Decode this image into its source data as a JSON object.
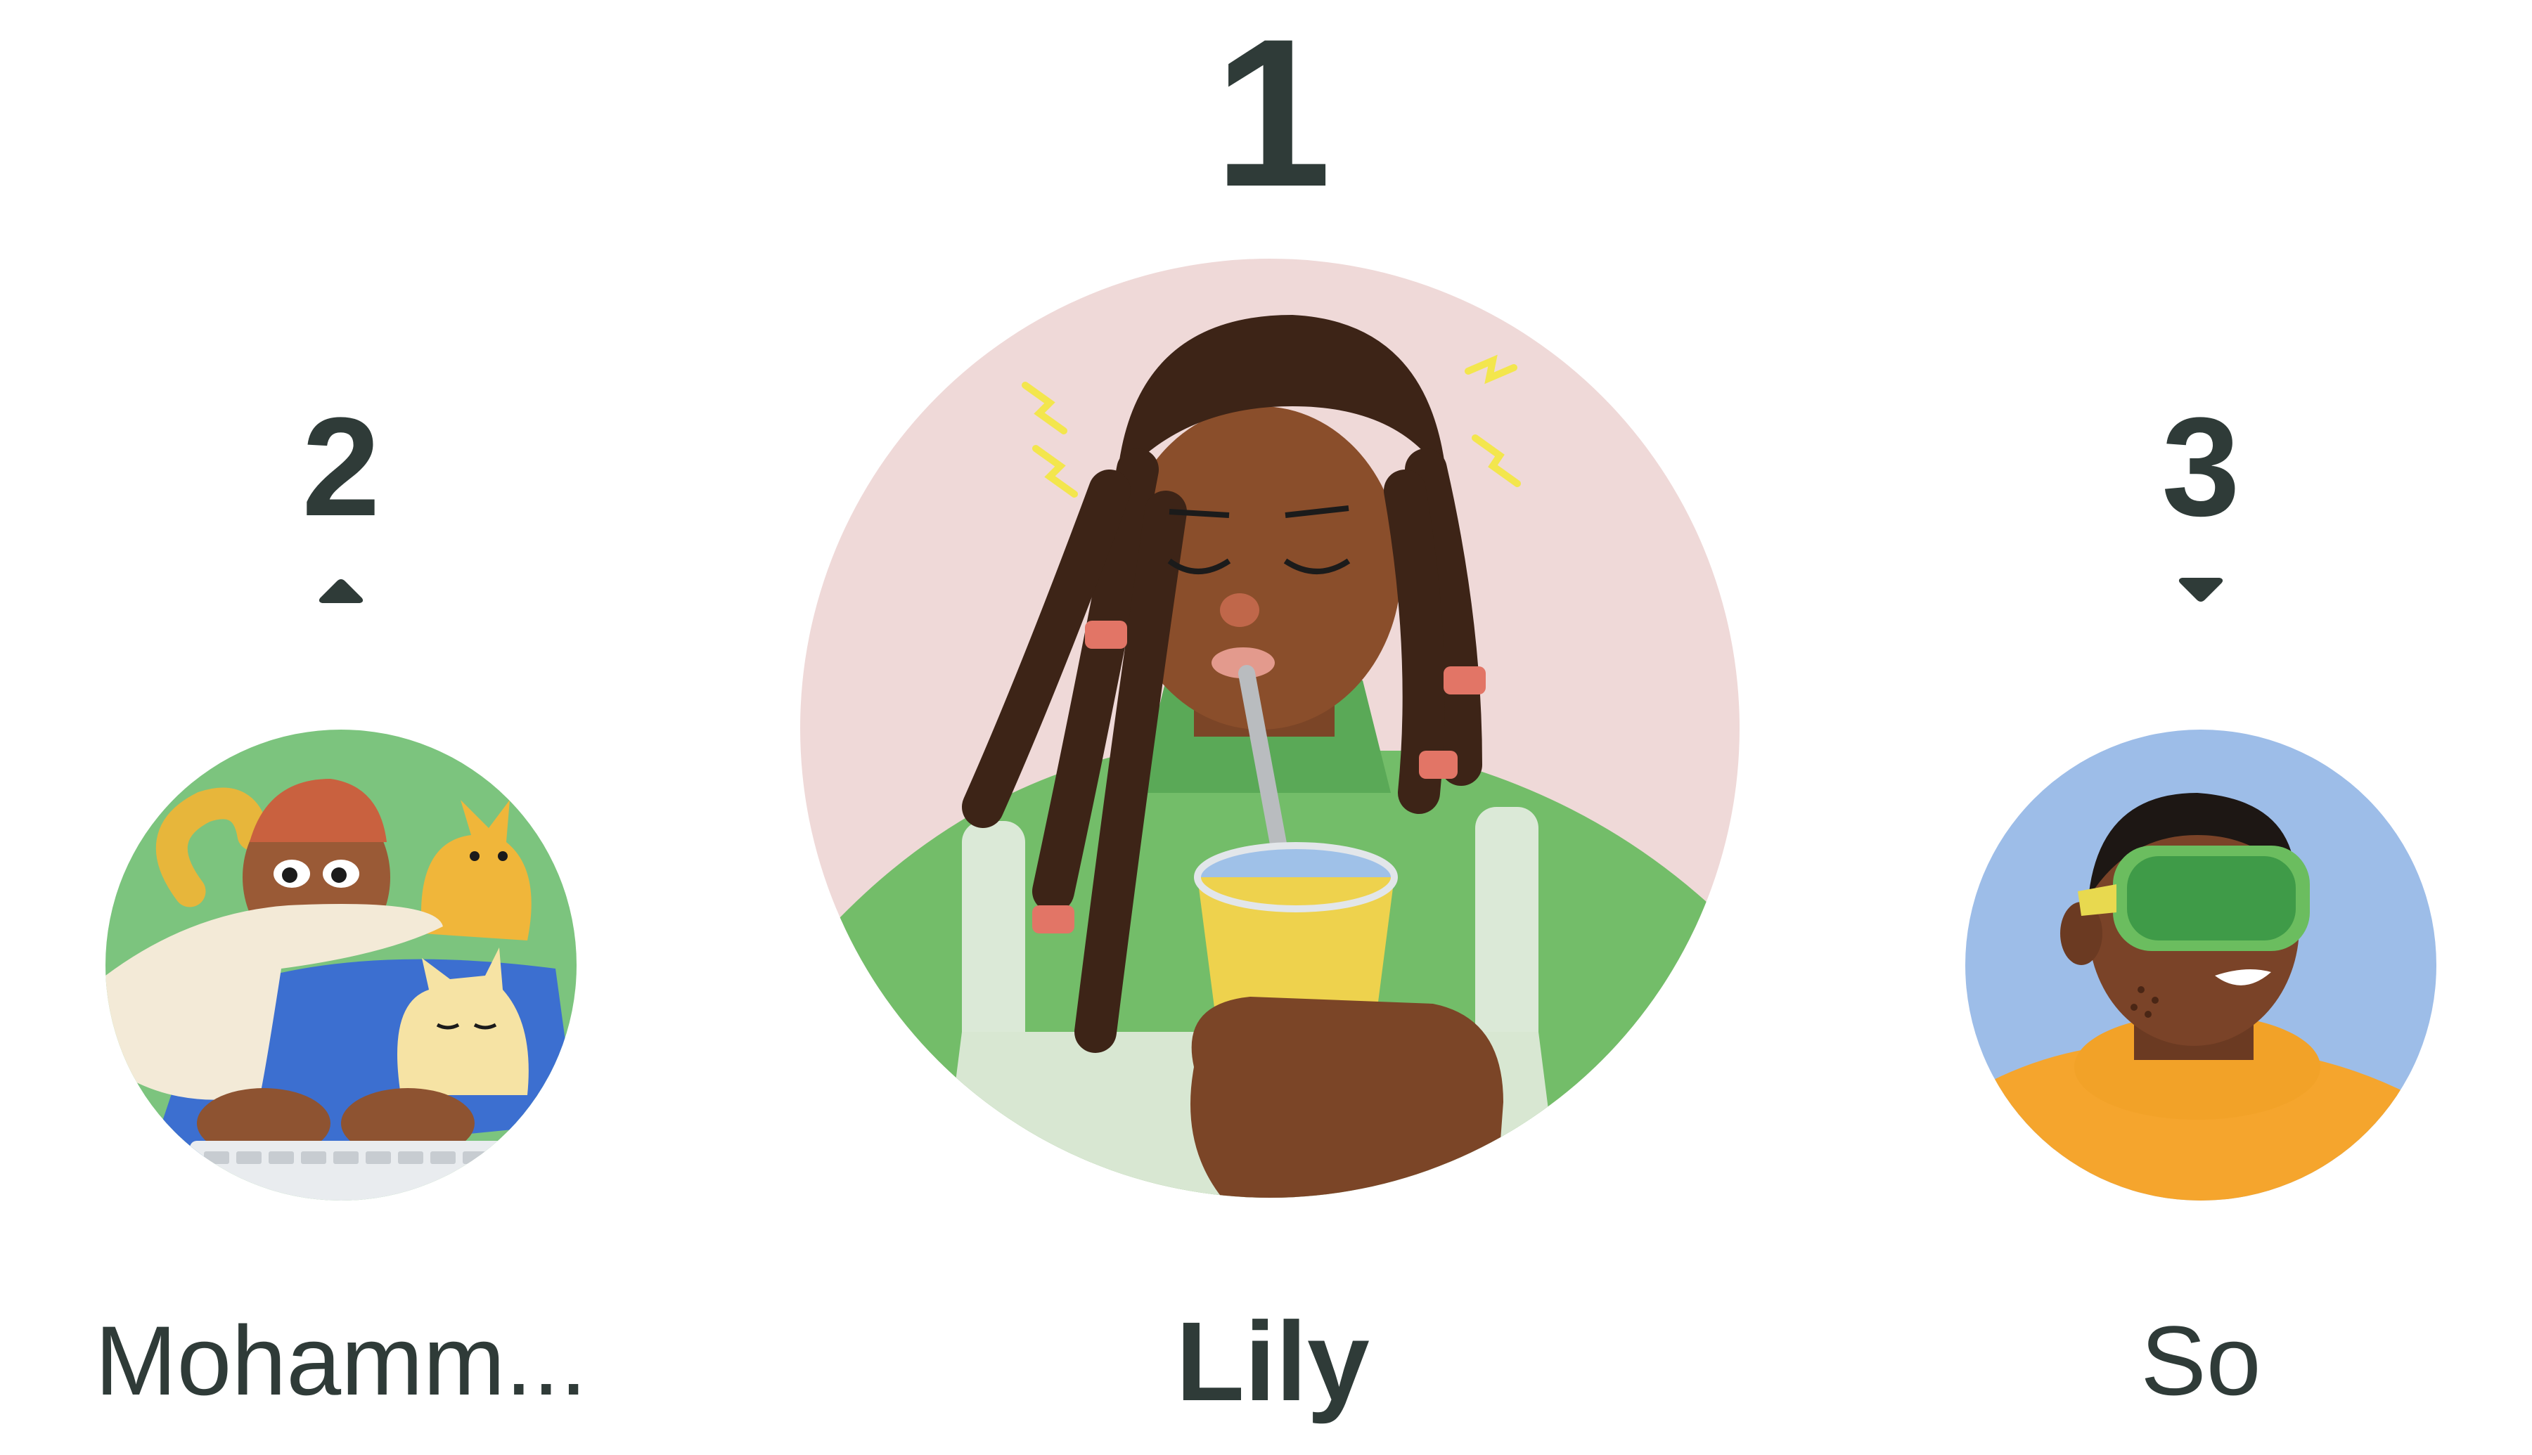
{
  "leaderboard": {
    "places": [
      {
        "rank": "1",
        "name": "Lily",
        "trend_icon": "none",
        "avatar_icon": "person-drinking-avatar",
        "avatar_bg": "#efd9d8"
      },
      {
        "rank": "2",
        "name": "Mohamm...",
        "trend_icon": "caret-up-icon",
        "avatar_icon": "person-typing-with-cats-avatar",
        "avatar_bg": "#7cc47e"
      },
      {
        "rank": "3",
        "name": "So",
        "trend_icon": "caret-down-icon",
        "avatar_icon": "person-vr-headset-avatar",
        "avatar_bg": "#9dbde8"
      }
    ]
  },
  "colors": {
    "text": "#2f3b38",
    "background": "#ffffff"
  }
}
